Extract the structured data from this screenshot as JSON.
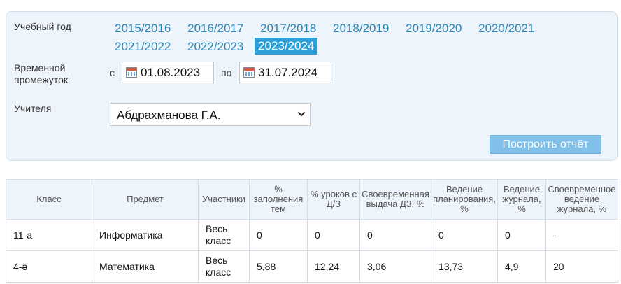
{
  "filters": {
    "year_label": "Учебный год",
    "years": [
      "2015/2016",
      "2016/2017",
      "2017/2018",
      "2018/2019",
      "2019/2020",
      "2020/2021",
      "2021/2022",
      "2022/2023",
      "2023/2024"
    ],
    "active_year": "2023/2024",
    "period_label": "Временной промежуток",
    "from_label": "с",
    "from_value": "01.08.2023",
    "to_label": "по",
    "to_value": "31.07.2024",
    "teacher_label": "Учителя",
    "teacher_value": "Абдрахманова Г.А.",
    "build_button": "Построить отчёт"
  },
  "table": {
    "headers": [
      "Класс",
      "Предмет",
      "Участники",
      "% заполнения тем",
      "% уроков с Д/З",
      "Своевременная выдача ДЗ, %",
      "Ведение планирования, %",
      "Ведение журнала, %",
      "Своевременное ведение журнала, %"
    ],
    "rows": [
      [
        "11-а",
        "Информатика",
        "Весь класс",
        "0",
        "0",
        "0",
        "0",
        "0",
        "-"
      ],
      [
        "4-ә",
        "Математика",
        "Весь класс",
        "5,88",
        "12,24",
        "3,06",
        "13,73",
        "4,9",
        "20"
      ]
    ]
  },
  "colors": {
    "accent": "#2d9fd6",
    "link": "#2a87b8",
    "panel_bg": "#eef4fb",
    "button_bg": "#7fbfe8"
  }
}
